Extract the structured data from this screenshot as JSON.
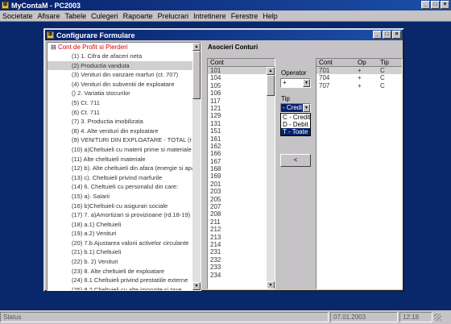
{
  "app": {
    "title": "MyContaM - PC2003",
    "icon": "app-icon",
    "win_buttons": [
      "_",
      "□",
      "×"
    ]
  },
  "menu": [
    "Societate",
    "Afisare",
    "Tabele",
    "Culegeri",
    "Rapoarte",
    "Prelucrari",
    "Intretinere",
    "Ferestre",
    "Help"
  ],
  "status": {
    "text": "Status",
    "date": "07.01.2003",
    "time": "12:18"
  },
  "dialog": {
    "title": "Configurare Formulare",
    "win_buttons": [
      "_",
      "□",
      "×"
    ],
    "tree": {
      "root": "Cont de Profit si Pierderi",
      "selected_index": 1,
      "items": [
        "(1)  1. Cifra de afaceri neta",
        "(2)  Productia vanduta",
        "(3)  Venituri din vanzare marfuri (ct. 707)",
        "(4)  Venituri din subventii de exploatare",
        "()  2. Variatia stocurilor",
        "(5)  Ct. 711",
        "(6)  Ct. 711",
        "(7)  3. Productia imobilizata",
        "(8)  4. Alte venituri din exploatare",
        "(9) VENITURI DIN EXPLOATARE - TOTAL (r",
        "(10)  a)Cheltuieli cu materii prime si materiale",
        "(11)  Alte cheltuieli materiale",
        "(12)  b). Alte cheltuieli din afara (energie si apa",
        "(13)  c). Cheltuieli privind marfurile",
        "(14)  6. Cheltuieli cu personalul     din care:",
        "(15)  a). Salarii",
        "(16)  b)Cheltuieli cu asigurari sociale",
        "(17)  7. a)Amortizari si provizioane (rd.18-19)",
        "(18)  a.1) Cheltuieli",
        "(19)  a.2) Venituri",
        "(20)  7.b.Ajustarea valorii activelor circulante",
        "(21)  b.1) Cheltuieli",
        "(22)  b. 2) Venituri",
        "(23)  8. Alte cheltuieli de exploatare",
        "(24)  8.1 Cheltuieli privind prestatiile externe",
        "(25)  8.2 Cheltuieli cu alte impozite si taxe"
      ]
    },
    "section_label": "Asocieri Conturi",
    "accounts": {
      "header": "Cont",
      "selected_index": 0,
      "rows": [
        "101",
        "104",
        "105",
        "106",
        "117",
        "121",
        "129",
        "131",
        "151",
        "161",
        "162",
        "166",
        "167",
        "168",
        "169",
        "201",
        "203",
        "205",
        "207",
        "208",
        "211",
        "212",
        "213",
        "214",
        "231",
        "232",
        "233",
        "234"
      ]
    },
    "operator": {
      "label": "Operator",
      "value": "+"
    },
    "tip": {
      "label": "Tip",
      "value": "- Credi",
      "options": [
        "C - Credit",
        "D - Debit",
        "T - Toate"
      ],
      "highlighted_index": 2
    },
    "move_left_button": "<",
    "assoc": {
      "headers": [
        "Cont",
        "Op",
        "Tip"
      ],
      "selected_index": 0,
      "rows": [
        [
          "701",
          "+",
          "C"
        ],
        [
          "704",
          "+",
          "C"
        ],
        [
          "707",
          "+",
          "C"
        ]
      ]
    }
  }
}
